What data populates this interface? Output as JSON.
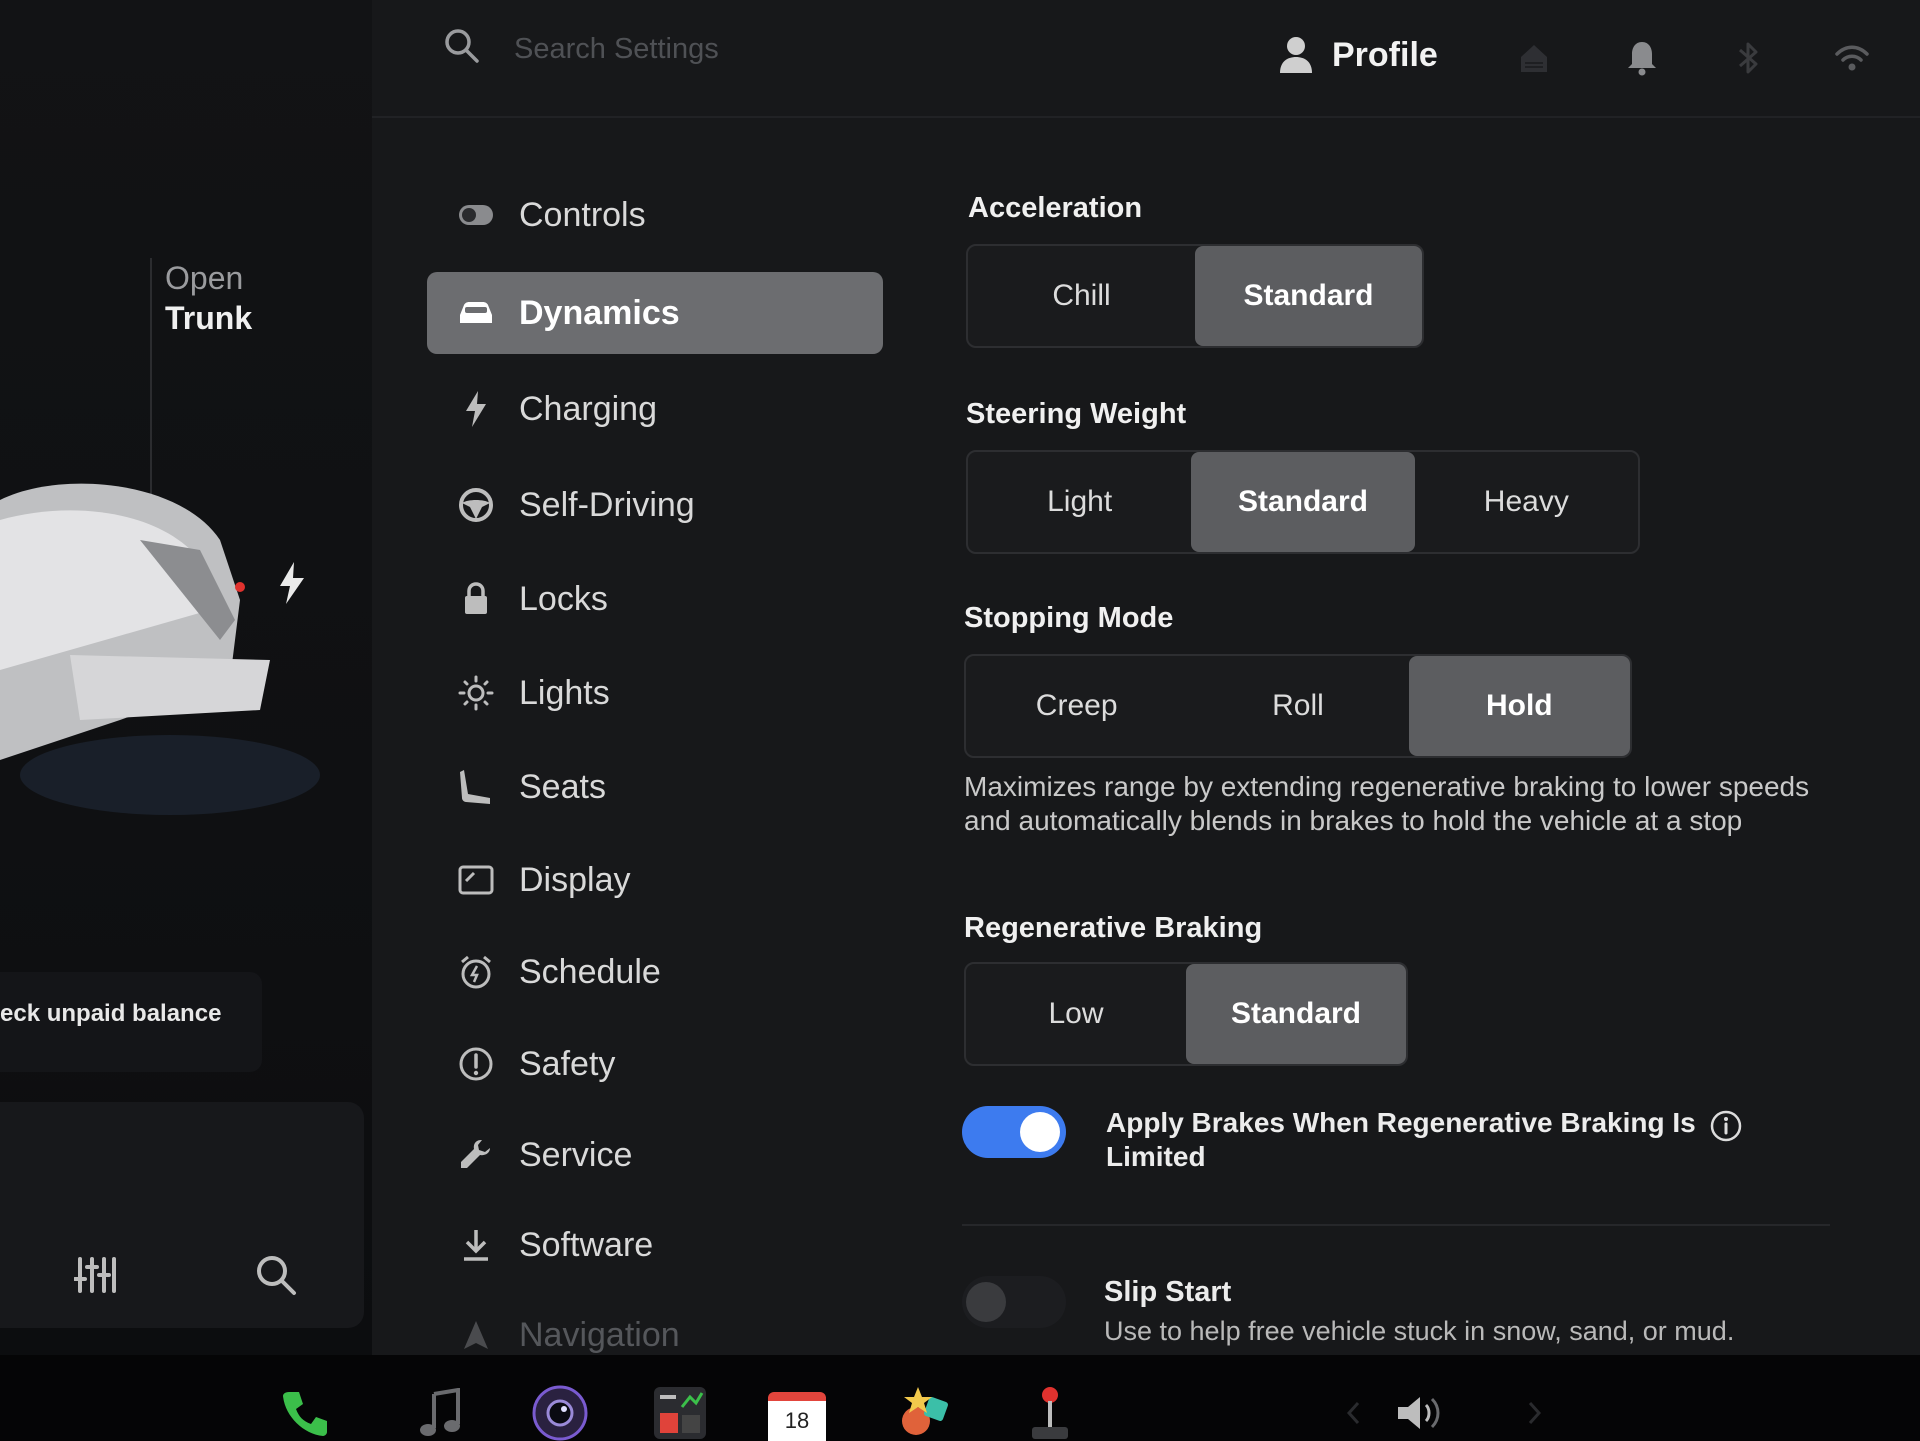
{
  "left_panel": {
    "trunk_line1": "Open",
    "trunk_line2": "Trunk",
    "balance_text": "eck unpaid balance",
    "tools": [
      "sliders-icon",
      "search-icon"
    ]
  },
  "header": {
    "search_placeholder": "Search Settings",
    "profile_label": "Profile",
    "status_icons": [
      "home-icon",
      "bell-icon",
      "bluetooth-icon",
      "wifi-icon"
    ]
  },
  "nav": {
    "items": [
      {
        "label": "Controls",
        "icon": "toggle-icon"
      },
      {
        "label": "Dynamics",
        "icon": "car-icon"
      },
      {
        "label": "Charging",
        "icon": "bolt-icon"
      },
      {
        "label": "Self-Driving",
        "icon": "steering-wheel-icon"
      },
      {
        "label": "Locks",
        "icon": "lock-icon"
      },
      {
        "label": "Lights",
        "icon": "sun-icon"
      },
      {
        "label": "Seats",
        "icon": "seat-icon"
      },
      {
        "label": "Display",
        "icon": "display-icon"
      },
      {
        "label": "Schedule",
        "icon": "alarm-clock-icon"
      },
      {
        "label": "Safety",
        "icon": "alert-circle-icon"
      },
      {
        "label": "Service",
        "icon": "wrench-icon"
      },
      {
        "label": "Software",
        "icon": "download-icon"
      },
      {
        "label": "Navigation",
        "icon": "navigation-arrow-icon"
      }
    ],
    "active": "Dynamics"
  },
  "content": {
    "acceleration": {
      "title": "Acceleration",
      "options": [
        "Chill",
        "Standard"
      ],
      "selected": "Standard"
    },
    "steering": {
      "title": "Steering Weight",
      "options": [
        "Light",
        "Standard",
        "Heavy"
      ],
      "selected": "Standard"
    },
    "stopping": {
      "title": "Stopping Mode",
      "options": [
        "Creep",
        "Roll",
        "Hold"
      ],
      "selected": "Hold",
      "description": "Maximizes range by extending regenerative braking to lower speeds and automatically blends in brakes to hold the vehicle at a stop"
    },
    "regen": {
      "title": "Regenerative Braking",
      "options": [
        "Low",
        "Standard"
      ],
      "selected": "Standard"
    },
    "apply_brakes": {
      "label": "Apply Brakes When Regenerative Braking Is Limited",
      "enabled": true
    },
    "slip_start": {
      "title": "Slip Start",
      "description": "Use to help free vehicle stuck in snow, sand, or mud.",
      "enabled": false
    }
  },
  "dock": {
    "items": [
      "phone-icon",
      "music-icon",
      "camera-icon",
      "dashcam-viewer-icon",
      "calendar-icon",
      "toybox-icon",
      "joystick-icon"
    ],
    "calendar_day": "18",
    "volume_icon": "volume-icon"
  },
  "colors": {
    "accent": "#3d7bef",
    "selected_segment": "#5c5d60",
    "active_nav": "#6c6d70",
    "background": "#17181a"
  }
}
